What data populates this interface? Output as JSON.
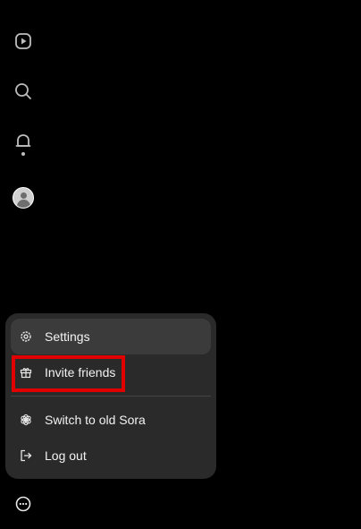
{
  "sidebar": {
    "icons": [
      {
        "name": "home-icon"
      },
      {
        "name": "search-icon"
      },
      {
        "name": "bell-icon"
      },
      {
        "name": "avatar"
      }
    ],
    "more_icon": "more-icon"
  },
  "menu": {
    "settings_label": "Settings",
    "invite_label": "Invite friends",
    "switch_label": "Switch to old Sora",
    "logout_label": "Log out"
  },
  "colors": {
    "background": "#000000",
    "menu_bg": "#2a2a2a",
    "menu_active_bg": "#3b3b3b",
    "highlight": "#e00000",
    "icon": "#bdbdbd"
  }
}
